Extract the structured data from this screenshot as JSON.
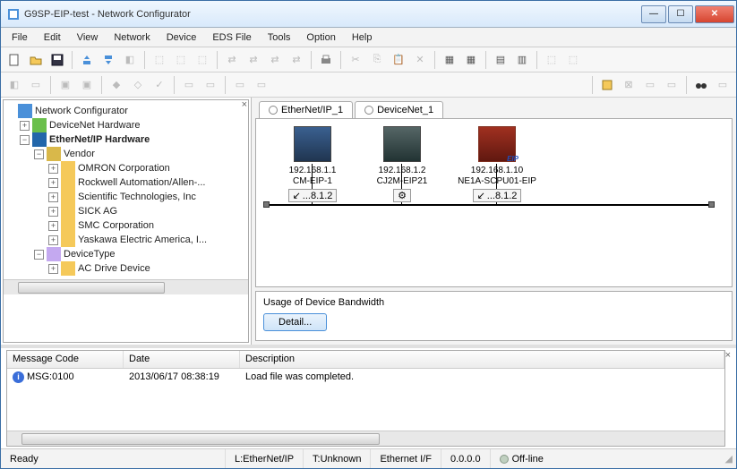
{
  "window": {
    "title": "G9SP-EIP-test - Network Configurator"
  },
  "menu": {
    "file": "File",
    "edit": "Edit",
    "view": "View",
    "network": "Network",
    "device": "Device",
    "eds": "EDS File",
    "tools": "Tools",
    "option": "Option",
    "help": "Help"
  },
  "tree": {
    "root": "Network Configurator",
    "devnet": "DeviceNet Hardware",
    "ethip": "EtherNet/IP Hardware",
    "vendor": "Vendor",
    "vendors": {
      "omron": "OMRON Corporation",
      "rockwell": "Rockwell Automation/Allen-...",
      "sti": "Scientific Technologies, Inc",
      "sick": "SICK AG",
      "smc": "SMC Corporation",
      "yaskawa": "Yaskawa Electric America, I..."
    },
    "devtype": "DeviceType",
    "acdrive": "AC Drive Device"
  },
  "tabs": {
    "t1": "EtherNet/IP_1",
    "t2": "DeviceNet_1"
  },
  "devices": {
    "d1": {
      "ip": "192.168.1.1",
      "name": "CM-EIP-1",
      "sub": "...8.1.2"
    },
    "d2": {
      "ip": "192.168.1.2",
      "name": "CJ2M-EIP21",
      "sub": ""
    },
    "d3": {
      "ip": "192.168.1.10",
      "name": "NE1A-SCPU01-EIP",
      "sub": "...8.1.2",
      "tag": "EIP"
    }
  },
  "bandwidth": {
    "label": "Usage of Device Bandwidth",
    "detail": "Detail..."
  },
  "msg": {
    "headers": {
      "code": "Message Code",
      "date": "Date",
      "desc": "Description"
    },
    "row": {
      "code": "MSG:0100",
      "date": "2013/06/17 08:38:19",
      "desc": "Load file was completed."
    }
  },
  "status": {
    "ready": "Ready",
    "net": "L:EtherNet/IP",
    "t": "T:Unknown",
    "if": "Ethernet I/F",
    "addr": "0.0.0.0",
    "off": "Off-line"
  }
}
